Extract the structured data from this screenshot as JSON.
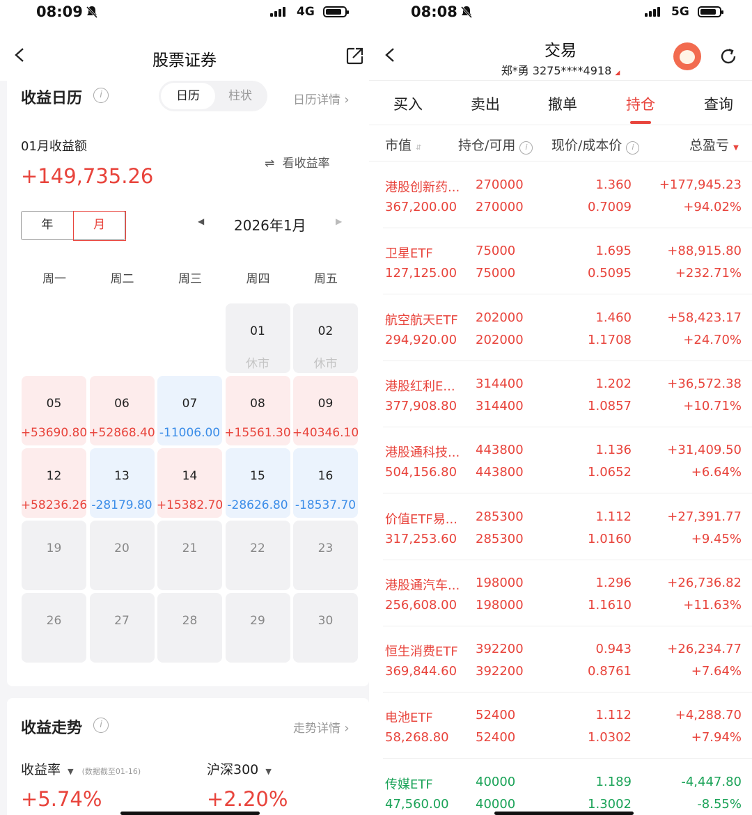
{
  "left": {
    "status": {
      "time": "08:09",
      "network": "4G"
    },
    "nav": {
      "title": "股票证券"
    },
    "calendar_section": {
      "title": "收益日历",
      "seg_calendar": "日历",
      "seg_bar": "柱状",
      "detail_link": "日历详情",
      "month_label": "01月收益额",
      "rate_toggle": "看收益率",
      "month_total": "+149,735.26",
      "year_btn": "年",
      "month_btn": "月",
      "current_month": "2026年1月",
      "weekdays": [
        "周一",
        "周二",
        "周三",
        "周四",
        "周五"
      ],
      "weeks": [
        [
          null,
          null,
          null,
          {
            "day": "01",
            "value": "休市",
            "kind": "hol"
          },
          {
            "day": "02",
            "value": "休市",
            "kind": "hol"
          }
        ],
        [
          {
            "day": "05",
            "value": "+53690.80",
            "kind": "red"
          },
          {
            "day": "06",
            "value": "+52868.40",
            "kind": "red"
          },
          {
            "day": "07",
            "value": "-11006.00",
            "kind": "blue"
          },
          {
            "day": "08",
            "value": "+15561.30",
            "kind": "red"
          },
          {
            "day": "09",
            "value": "+40346.10",
            "kind": "red"
          }
        ],
        [
          {
            "day": "12",
            "value": "+58236.26",
            "kind": "red"
          },
          {
            "day": "13",
            "value": "-28179.80",
            "kind": "blue"
          },
          {
            "day": "14",
            "value": "+15382.70",
            "kind": "red"
          },
          {
            "day": "15",
            "value": "-28626.80",
            "kind": "blue"
          },
          {
            "day": "16",
            "value": "-18537.70",
            "kind": "blue"
          }
        ],
        [
          {
            "day": "19",
            "value": "",
            "kind": "gray"
          },
          {
            "day": "20",
            "value": "",
            "kind": "gray"
          },
          {
            "day": "21",
            "value": "",
            "kind": "gray"
          },
          {
            "day": "22",
            "value": "",
            "kind": "gray"
          },
          {
            "day": "23",
            "value": "",
            "kind": "gray"
          }
        ],
        [
          {
            "day": "26",
            "value": "",
            "kind": "gray"
          },
          {
            "day": "27",
            "value": "",
            "kind": "gray"
          },
          {
            "day": "28",
            "value": "",
            "kind": "gray"
          },
          {
            "day": "29",
            "value": "",
            "kind": "gray"
          },
          {
            "day": "30",
            "value": "",
            "kind": "gray"
          }
        ]
      ]
    },
    "trend_section": {
      "title": "收益走势",
      "detail_link": "走势详情",
      "rate_label": "收益率",
      "data_note": "(数据截至01-16)",
      "index_label": "沪深300",
      "rate_value": "+5.74%",
      "index_value": "+2.20%"
    }
  },
  "right": {
    "status": {
      "time": "08:08",
      "network": "5G"
    },
    "nav": {
      "title": "交易",
      "account": "郑*勇 3275****4918"
    },
    "tabs": [
      "买入",
      "卖出",
      "撤单",
      "持仓",
      "查询"
    ],
    "active_tab_index": 3,
    "columns": [
      "市值",
      "持仓/可用",
      "现价/成本价",
      "总盈亏"
    ],
    "holdings": [
      {
        "name": "港股创新药...",
        "market_value": "367,200.00",
        "position": "270000",
        "available": "270000",
        "price": "1.360",
        "cost": "0.7009",
        "pnl": "+177,945.23",
        "pnl_pct": "+94.02%",
        "dir": "up"
      },
      {
        "name": "卫星ETF",
        "market_value": "127,125.00",
        "position": "75000",
        "available": "75000",
        "price": "1.695",
        "cost": "0.5095",
        "pnl": "+88,915.80",
        "pnl_pct": "+232.71%",
        "dir": "up"
      },
      {
        "name": "航空航天ETF",
        "market_value": "294,920.00",
        "position": "202000",
        "available": "202000",
        "price": "1.460",
        "cost": "1.1708",
        "pnl": "+58,423.17",
        "pnl_pct": "+24.70%",
        "dir": "up"
      },
      {
        "name": "港股红利E...",
        "market_value": "377,908.80",
        "position": "314400",
        "available": "314400",
        "price": "1.202",
        "cost": "1.0857",
        "pnl": "+36,572.38",
        "pnl_pct": "+10.71%",
        "dir": "up"
      },
      {
        "name": "港股通科技...",
        "market_value": "504,156.80",
        "position": "443800",
        "available": "443800",
        "price": "1.136",
        "cost": "1.0652",
        "pnl": "+31,409.50",
        "pnl_pct": "+6.64%",
        "dir": "up"
      },
      {
        "name": "价值ETF易...",
        "market_value": "317,253.60",
        "position": "285300",
        "available": "285300",
        "price": "1.112",
        "cost": "1.0160",
        "pnl": "+27,391.77",
        "pnl_pct": "+9.45%",
        "dir": "up"
      },
      {
        "name": "港股通汽车...",
        "market_value": "256,608.00",
        "position": "198000",
        "available": "198000",
        "price": "1.296",
        "cost": "1.1610",
        "pnl": "+26,736.82",
        "pnl_pct": "+11.63%",
        "dir": "up"
      },
      {
        "name": "恒生消费ETF",
        "market_value": "369,844.60",
        "position": "392200",
        "available": "392200",
        "price": "0.943",
        "cost": "0.8761",
        "pnl": "+26,234.77",
        "pnl_pct": "+7.64%",
        "dir": "up"
      },
      {
        "name": "电池ETF",
        "market_value": "58,268.80",
        "position": "52400",
        "available": "52400",
        "price": "1.112",
        "cost": "1.0302",
        "pnl": "+4,288.70",
        "pnl_pct": "+7.94%",
        "dir": "up"
      },
      {
        "name": "传媒ETF",
        "market_value": "47,560.00",
        "position": "40000",
        "available": "40000",
        "price": "1.189",
        "cost": "1.3002",
        "pnl": "-4,447.80",
        "pnl_pct": "-8.55%",
        "dir": "down"
      }
    ]
  },
  "colors": {
    "up": "#e8443c",
    "down": "#1ba358",
    "loss_day": "#3c8de8"
  }
}
